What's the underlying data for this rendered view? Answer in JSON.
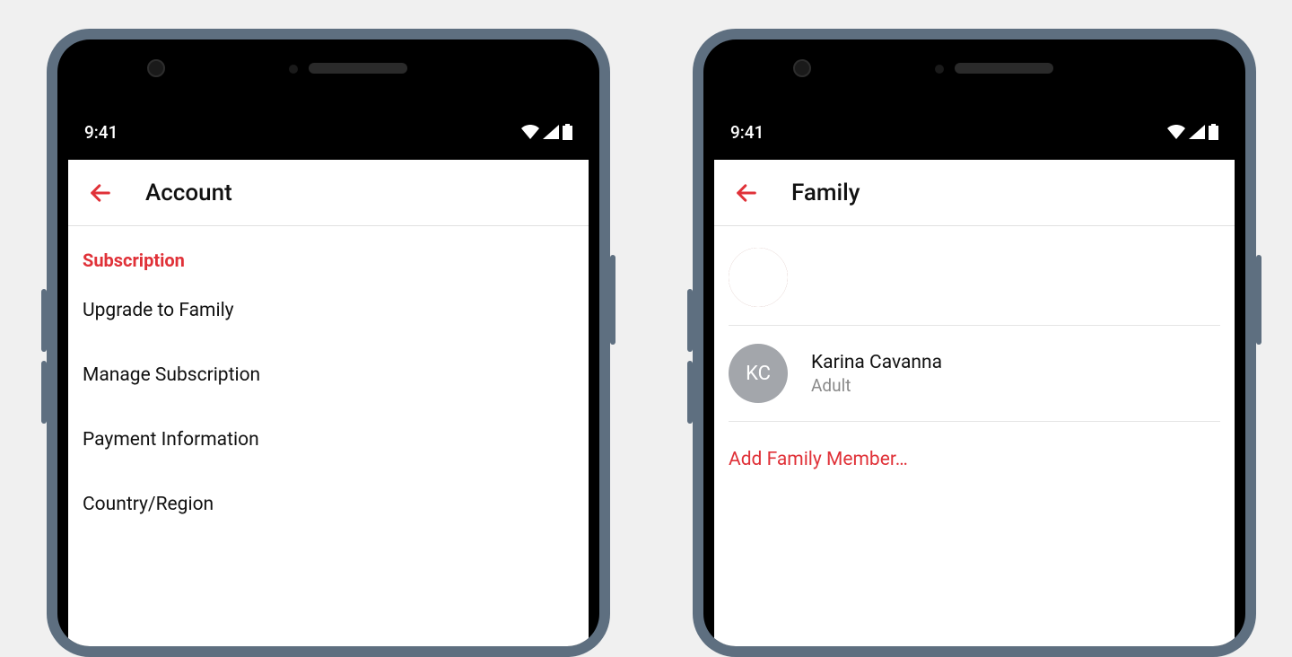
{
  "status": {
    "time": "9:41"
  },
  "left_screen": {
    "title": "Account",
    "section_header": "Subscription",
    "items": [
      "Upgrade to Family",
      "Manage Subscription",
      "Payment Information",
      "Country/Region"
    ]
  },
  "right_screen": {
    "title": "Family",
    "members": [
      {
        "name": "",
        "role": "",
        "initials": ""
      },
      {
        "name": "Karina Cavanna",
        "role": "Adult",
        "initials": "KC"
      }
    ],
    "add_link": "Add Family Member…"
  },
  "colors": {
    "accent": "#e03138",
    "phone_body": "#5e6f80"
  }
}
